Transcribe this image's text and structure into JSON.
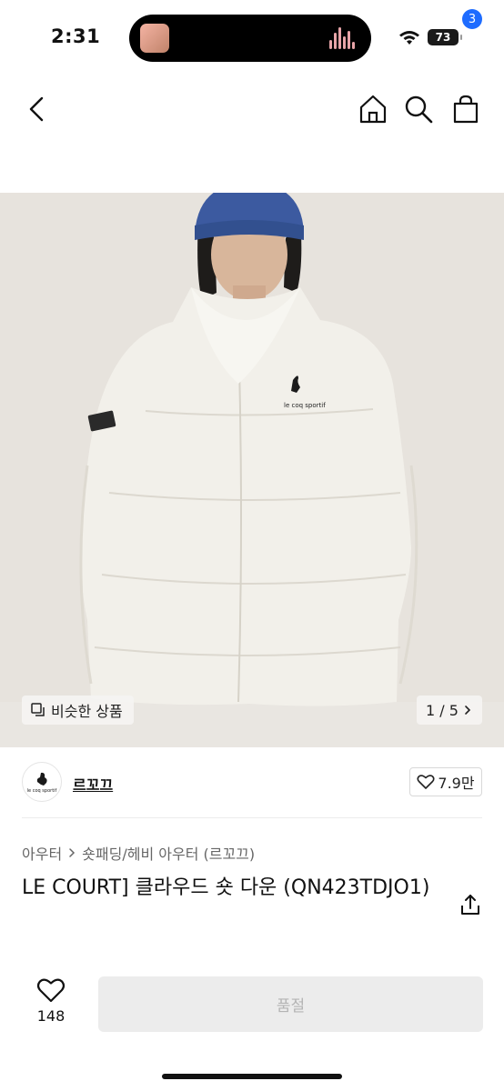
{
  "status_bar": {
    "time": "2:31",
    "battery": "73"
  },
  "nav": {
    "cart_count": "3"
  },
  "gallery": {
    "similar_label": "비슷한 상품",
    "page": "1 / 5"
  },
  "brand": {
    "name": "르꼬끄",
    "logo_text": "le coq sportif",
    "likes": "7.9만"
  },
  "category": {
    "level1": "아우터",
    "level2": "숏패딩/헤비 아우터 (르꼬끄)"
  },
  "product": {
    "title": "LE COURT] 클라우드 숏 다운 (QN423TDJO1)"
  },
  "bottom": {
    "wish_count": "148",
    "soldout_label": "품절"
  },
  "colors": {
    "accent": "#1e6cff",
    "disabled_bg": "#ececec",
    "disabled_text": "#b4b4b4",
    "image_bg": "#e6e2dc"
  }
}
